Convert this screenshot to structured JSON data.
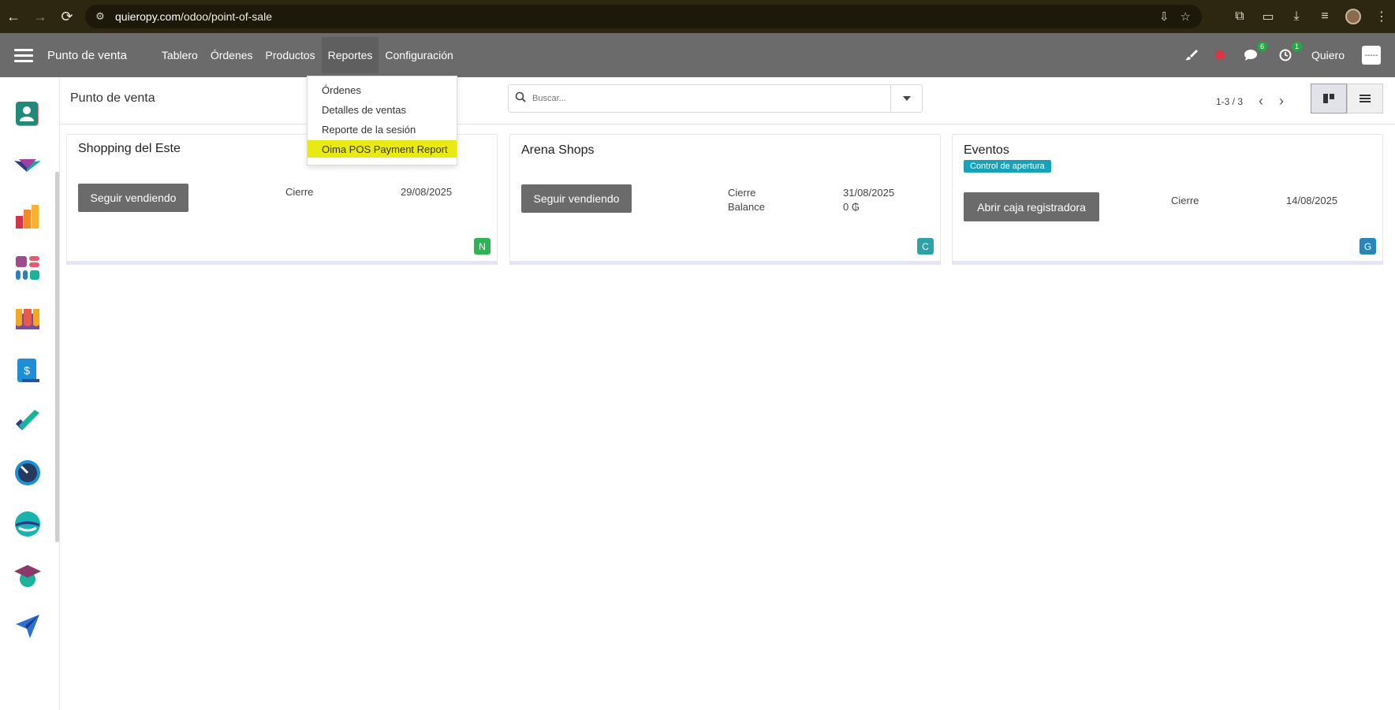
{
  "browser": {
    "url_host": "quieropy.com",
    "url_path": "/odoo/point-of-sale"
  },
  "navbar": {
    "app_title": "Punto de venta",
    "menu": [
      "Tablero",
      "Órdenes",
      "Productos",
      "Reportes",
      "Configuración"
    ],
    "messages_count": "6",
    "activities_count": "1",
    "user_name": "Quiero",
    "user_avatar_text": "-----"
  },
  "reports_menu": {
    "items": [
      "Órdenes",
      "Detalles de ventas",
      "Reporte de la sesión",
      "Oima POS Payment Report"
    ],
    "highlighted_index": 3
  },
  "control_panel": {
    "breadcrumb": "Punto de venta",
    "search_placeholder": "Buscar...",
    "pager": "1-3 / 3"
  },
  "cards": [
    {
      "name": "Shopping del Este",
      "button": "Seguir vendiendo",
      "closing_label": "Cierre",
      "closing_date": "29/08/2025",
      "corner_letter": "N",
      "corner_color": "#2eb454"
    },
    {
      "name": "Arena Shops",
      "button": "Seguir vendiendo",
      "closing_label": "Cierre",
      "closing_date": "31/08/2025",
      "balance_label": "Balance",
      "balance_value": "0 ₲",
      "corner_letter": "C",
      "corner_color": "#2ba3a8"
    },
    {
      "name": "Eventos",
      "tag": "Control de apertura",
      "button": "Abrir caja registradora",
      "closing_label": "Cierre",
      "closing_date": "14/08/2025",
      "corner_letter": "G",
      "corner_color": "#2a86b8"
    }
  ],
  "sidebar_apps": [
    "contacts-app-icon",
    "crm-app-icon",
    "sales-app-icon",
    "dashboard-app-icon",
    "pos-app-icon",
    "invoicing-app-icon",
    "project-app-icon",
    "timesheets-app-icon",
    "discuss-app-icon",
    "elearning-app-icon",
    "email-marketing-app-icon"
  ]
}
